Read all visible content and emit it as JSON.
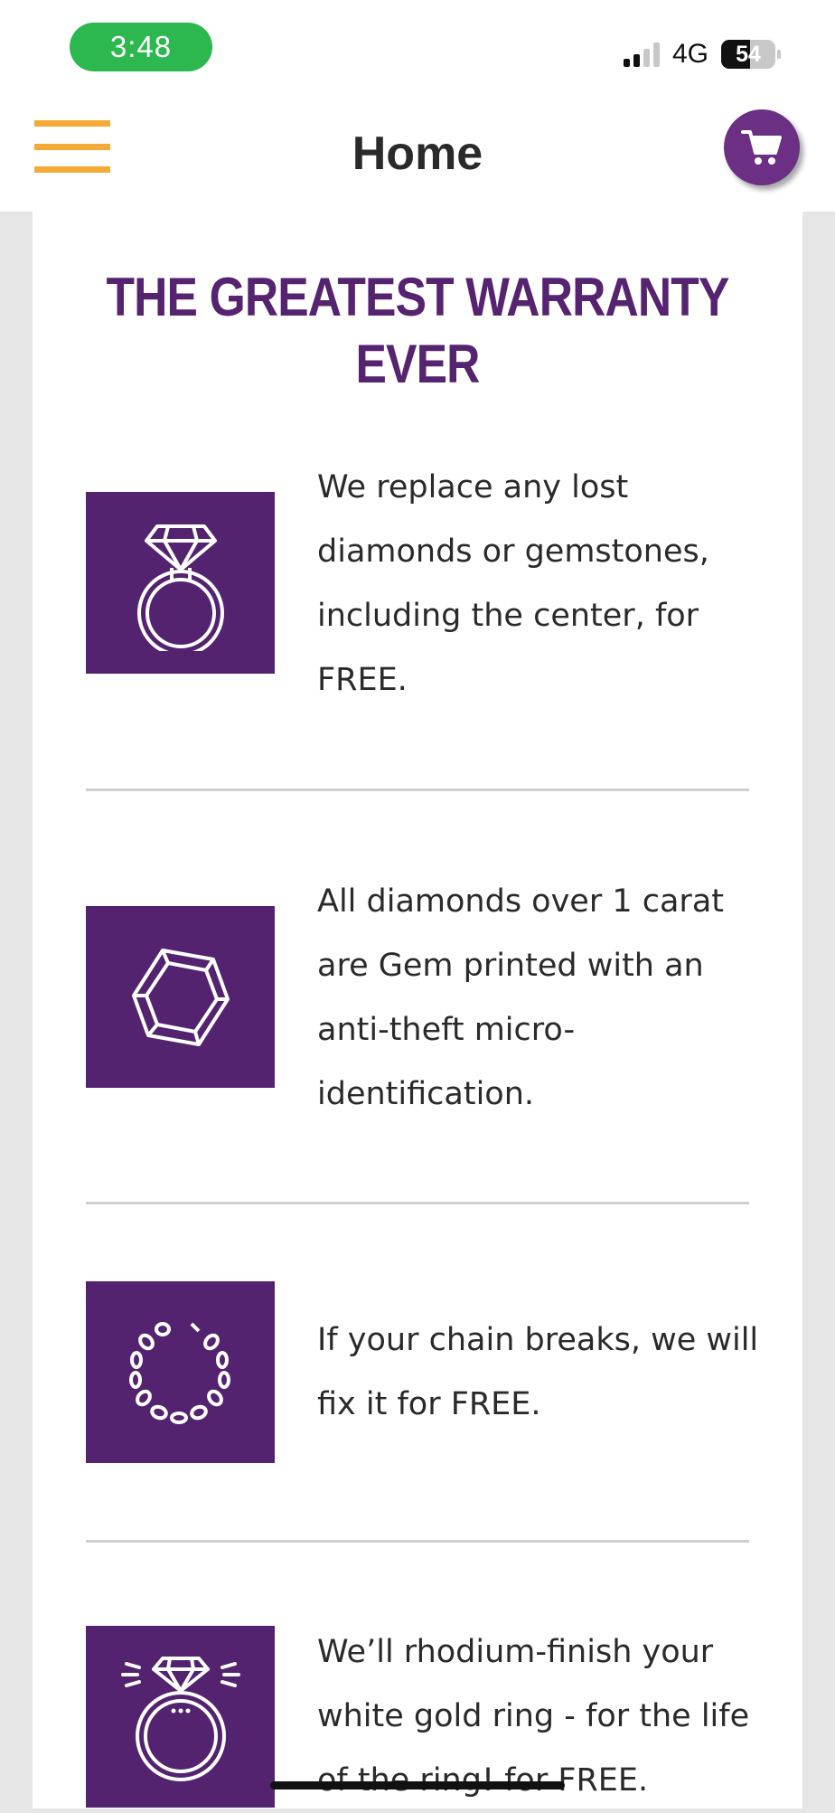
{
  "status_bar": {
    "time": "3:48",
    "network": "4G",
    "battery_level": "54",
    "battery_fraction": 0.54,
    "signal_bars": 2,
    "signal_bars_total": 4
  },
  "header": {
    "title": "Home",
    "menu_icon": "hamburger-menu-icon",
    "cart_icon": "shopping-cart-icon"
  },
  "colors": {
    "accent_purple": "#54236f",
    "menu_orange": "#f3ab36",
    "time_pill_green": "#2db84f"
  },
  "main": {
    "heading": "THE GREATEST WARRANTY EVER",
    "features": [
      {
        "icon": "diamond-ring-icon",
        "text": "We replace any lost diamonds or gemstones, including the center, for FREE."
      },
      {
        "icon": "gemstone-icon",
        "text": "All diamonds over 1 carat are Gem printed with an anti-theft micro-identification."
      },
      {
        "icon": "chain-icon",
        "text": "If your chain breaks, we will fix it for FREE."
      },
      {
        "icon": "sparkling-ring-icon",
        "text": "We’ll rhodium-finish your white gold ring - for the life of the ring! for FREE."
      }
    ]
  }
}
